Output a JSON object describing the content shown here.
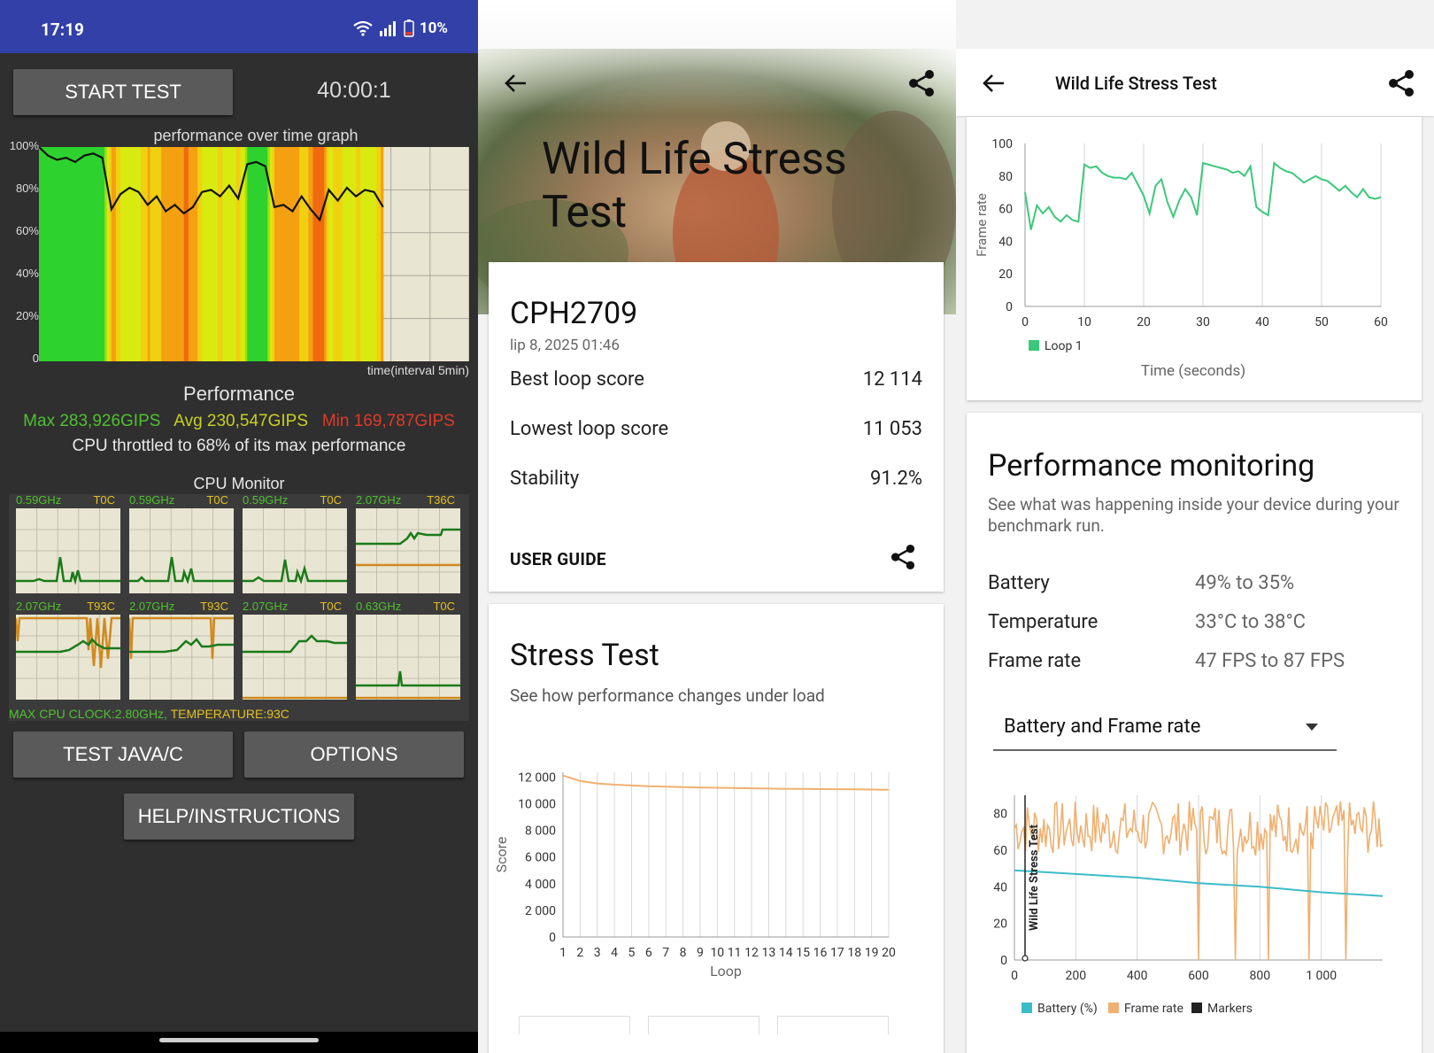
{
  "p1": {
    "status": {
      "time": "17:19",
      "battery": "10%"
    },
    "start_label": "START TEST",
    "timer": "40:00:1",
    "graph_title": "performance over time graph",
    "y_labels": [
      "100%",
      "80%",
      "60%",
      "40%",
      "20%",
      "0"
    ],
    "x_label": "time(interval 5min)",
    "perf_title": "Performance",
    "max": "Max 283,926GIPS",
    "avg": "Avg 230,547GIPS",
    "min": "Min 169,787GIPS",
    "throttle": "CPU throttled to 68% of its max performance",
    "cpu_title": "CPU Monitor",
    "cores": [
      {
        "freq": "0.59GHz",
        "temp": "T0C"
      },
      {
        "freq": "0.59GHz",
        "temp": "T0C"
      },
      {
        "freq": "0.59GHz",
        "temp": "T0C"
      },
      {
        "freq": "2.07GHz",
        "temp": "T36C"
      },
      {
        "freq": "2.07GHz",
        "temp": "T93C"
      },
      {
        "freq": "2.07GHz",
        "temp": "T93C"
      },
      {
        "freq": "2.07GHz",
        "temp": "T0C"
      },
      {
        "freq": "0.63GHz",
        "temp": "T0C"
      }
    ],
    "max_cpu_a": "MAX CPU CLOCK:2.80GHz, ",
    "max_cpu_b": "TEMPERATURE:93C",
    "java_label": "TEST JAVA/C",
    "options_label": "OPTIONS",
    "help_label": "HELP/INSTRUCTIONS",
    "colors": {
      "bg": "#2f2f2f",
      "status": "#3240a8",
      "max": "#50c030",
      "avg": "#c8d020",
      "min": "#e03a2a"
    }
  },
  "p2": {
    "hero_title": "Wild Life Stress Test",
    "device": "CPH2709",
    "date": "lip 8, 2025 01:46",
    "rows": [
      {
        "label": "Best loop score",
        "value": "12 114"
      },
      {
        "label": "Lowest loop score",
        "value": "11 053"
      },
      {
        "label": "Stability",
        "value": "91.2%"
      }
    ],
    "user_guide": "USER GUIDE",
    "stress_title": "Stress Test",
    "stress_sub": "See how performance changes under load",
    "chart_y_title": "Score",
    "chart_x_title": "Loop"
  },
  "p3": {
    "header_title": "Wild Life Stress Test",
    "fr_y_title": "Frame rate",
    "fr_x_title": "Time (seconds)",
    "fr_legend": "Loop 1",
    "pm_title": "Performance monitoring",
    "pm_sub": "See what was happening inside your device during your benchmark run.",
    "pm_rows": [
      {
        "label": "Battery",
        "value": "49% to 35%"
      },
      {
        "label": "Temperature",
        "value": "33°C to 38°C"
      },
      {
        "label": "Frame rate",
        "value": "47 FPS to 87 FPS"
      }
    ],
    "dropdown_value": "Battery and Frame rate",
    "bf_side_label": "Wild Life Stress Test",
    "bf_legend": [
      "Battery (%)",
      "Frame rate",
      "Markers"
    ]
  },
  "chart_data": [
    {
      "type": "area",
      "title": "performance over time graph",
      "xlabel": "time(interval 5min)",
      "ylabel": "",
      "ylim": [
        0,
        100
      ],
      "y_ticks": [
        "0",
        "20%",
        "40%",
        "60%",
        "80%",
        "100%"
      ],
      "series": [
        {
          "values": [
            100,
            96,
            94,
            95,
            93,
            96,
            97,
            95,
            71,
            78,
            81,
            79,
            73,
            77,
            70,
            73,
            69,
            72,
            79,
            80,
            77,
            82,
            76,
            92,
            93,
            91,
            72,
            73,
            70,
            77,
            71,
            66,
            80,
            75,
            81,
            77,
            80,
            79,
            72
          ]
        }
      ]
    },
    {
      "type": "line",
      "xlabel": "Loop",
      "ylabel": "Score",
      "ylim": [
        0,
        12000
      ],
      "y_ticks": [
        "0",
        "2 000",
        "4 000",
        "6 000",
        "8 000",
        "10 000",
        "12 000"
      ],
      "categories": [
        "1",
        "2",
        "3",
        "4",
        "5",
        "6",
        "7",
        "8",
        "9",
        "10",
        "11",
        "12",
        "13",
        "14",
        "15",
        "16",
        "17",
        "18",
        "19",
        "20"
      ],
      "values": [
        12114,
        11700,
        11520,
        11430,
        11370,
        11320,
        11280,
        11250,
        11220,
        11200,
        11180,
        11160,
        11140,
        11120,
        11110,
        11100,
        11090,
        11075,
        11065,
        11053
      ]
    },
    {
      "type": "line",
      "xlabel": "Time (seconds)",
      "ylabel": "Frame rate",
      "ylim": [
        0,
        100
      ],
      "x_ticks": [
        "0",
        "10",
        "20",
        "30",
        "40",
        "50",
        "60"
      ],
      "y_ticks": [
        "0",
        "20",
        "40",
        "60",
        "80",
        "100"
      ],
      "legend": [
        "Loop 1"
      ],
      "x": [
        0,
        1,
        2,
        3,
        4,
        5,
        6,
        7,
        8,
        9,
        10,
        11,
        12,
        13,
        14,
        15,
        16,
        17,
        18,
        19,
        20,
        21,
        22,
        23,
        24,
        25,
        26,
        27,
        28,
        29,
        30,
        31,
        32,
        33,
        34,
        35,
        36,
        37,
        38,
        39,
        40,
        41,
        42,
        43,
        44,
        45,
        46,
        47,
        48,
        49,
        50,
        51,
        52,
        53,
        54,
        55,
        56,
        57,
        58,
        59,
        60
      ],
      "values": [
        70,
        47,
        62,
        57,
        61,
        55,
        52,
        56,
        53,
        52,
        87,
        85,
        86,
        82,
        80,
        79,
        79,
        78,
        82,
        75,
        68,
        57,
        74,
        78,
        64,
        55,
        65,
        72,
        67,
        56,
        88,
        87,
        86,
        85,
        84,
        82,
        83,
        80,
        86,
        61,
        58,
        56,
        88,
        85,
        83,
        82,
        79,
        76,
        78,
        80,
        78,
        77,
        74,
        71,
        74,
        70,
        67,
        72,
        67,
        66,
        67
      ]
    },
    {
      "type": "line",
      "xlabel": "",
      "ylabel": "Wild Life Stress Test",
      "ylim": [
        0,
        90
      ],
      "x_ticks": [
        "0",
        "200",
        "400",
        "600",
        "800",
        "1 000"
      ],
      "y_ticks": [
        "0",
        "20",
        "40",
        "60",
        "80"
      ],
      "legend": [
        "Battery (%)",
        "Frame rate",
        "Markers"
      ],
      "series": [
        {
          "name": "Battery (%)",
          "x": [
            0,
            200,
            400,
            600,
            800,
            1000,
            1200
          ],
          "values": [
            49,
            47,
            45,
            42,
            40,
            37,
            35
          ]
        },
        {
          "name": "Frame rate",
          "x_range": [
            0,
            1200
          ],
          "values_min": 47,
          "values_max": 87,
          "dips_at": [
            600,
            720,
            830,
            960,
            1080
          ]
        }
      ]
    }
  ]
}
